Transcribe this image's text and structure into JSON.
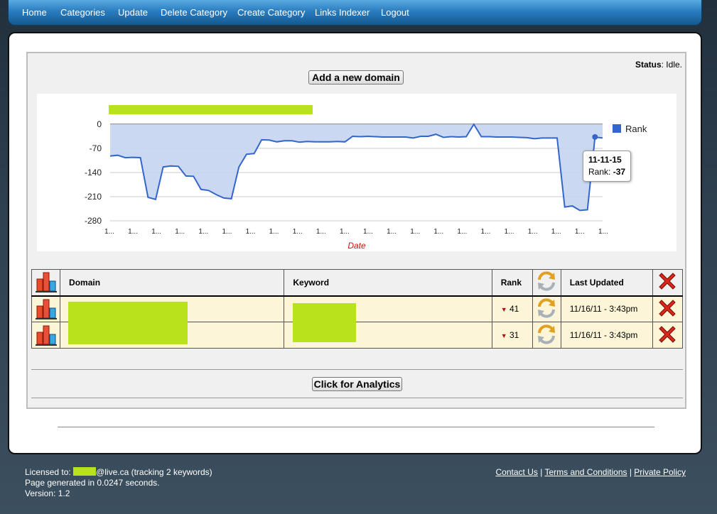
{
  "nav": {
    "items": [
      "Home",
      "Categories",
      "Update",
      "Delete Category",
      "Create Category",
      "Links Indexer",
      "Logout"
    ]
  },
  "status": {
    "label": "Status",
    "value": ": Idle."
  },
  "buttons": {
    "add_domain": "Add a new domain",
    "analytics": "Click for Analytics"
  },
  "chart_data": {
    "type": "area",
    "series": [
      {
        "name": "Rank",
        "color": "#3366cc"
      }
    ],
    "xlabel": "Date",
    "ylabel": "",
    "ylim": [
      -280,
      0
    ],
    "yticks": [
      "0",
      "-70",
      "-140",
      "-210",
      "-280"
    ],
    "xtick_label": "1...",
    "x_count": 22,
    "values": [
      -92,
      -90,
      -97,
      -96,
      -97,
      -212,
      -218,
      -124,
      -121,
      -122,
      -150,
      -151,
      -189,
      -192,
      -204,
      -214,
      -216,
      -124,
      -87,
      -85,
      -45,
      -46,
      -51,
      -48,
      -48,
      -52,
      -50,
      -51,
      -51,
      -51,
      -50,
      -51,
      -35,
      -36,
      -35,
      -36,
      -37,
      -37,
      -37,
      -37,
      -40,
      -35,
      -35,
      -29,
      -38,
      -36,
      -37,
      -36,
      0,
      -36,
      -36,
      -37,
      -37,
      -37,
      -38,
      -39,
      -42,
      -40,
      -40,
      -40,
      -240,
      -237,
      -250,
      -248,
      -37,
      -40
    ],
    "tooltip": {
      "date": "11-11-15",
      "label": "Rank:",
      "value": "-37"
    },
    "legend_position": "right",
    "grid": true
  },
  "table": {
    "headers": {
      "domain": "Domain",
      "keyword": "Keyword",
      "rank": "Rank",
      "updated": "Last Updated"
    },
    "rows": [
      {
        "rank": "41",
        "updated": "11/16/11 - 3:43pm"
      },
      {
        "rank": "31",
        "updated": "11/16/11 - 3:43pm"
      }
    ]
  },
  "footer": {
    "licensed_prefix": "Licensed to:",
    "licensed_suffix": "@live.ca (tracking 2 keywords)",
    "generated": "Page generated in 0.0247 seconds.",
    "version": "Version: 1.2",
    "links": [
      "Contact Us",
      "Terms and Conditions",
      "Private Policy"
    ]
  },
  "colors": {
    "highlight": "#b8e21c",
    "chart_line": "#3366cc",
    "chart_fill": "#c5d4f0",
    "row_bg": "#fdf5d8"
  }
}
